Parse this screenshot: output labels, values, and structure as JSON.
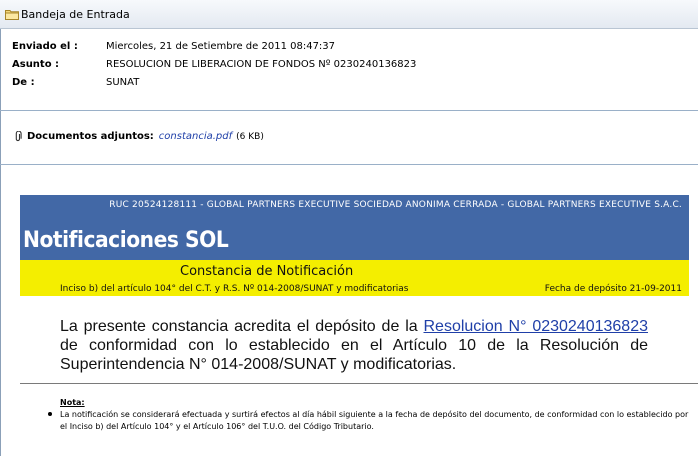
{
  "window": {
    "title": "Bandeja de Entrada",
    "icon": "folder-icon"
  },
  "headers": [
    {
      "label": "Enviado el :",
      "value": "Miercoles, 21 de Setiembre de 2011 08:47:37"
    },
    {
      "label": "Asunto :",
      "value": "RESOLUCION DE LIBERACION DE FONDOS Nº 0230240136823"
    },
    {
      "label": "De :",
      "value": "SUNAT"
    }
  ],
  "attachments": {
    "label": "Documentos adjuntos:",
    "file": "constancia.pdf",
    "size": "(6 KB)",
    "icon": "paperclip-icon"
  },
  "notice": {
    "ruc_line": "RUC 20524128111 - GLOBAL PARTNERS EXECUTIVE SOCIEDAD ANONIMA CERRADA - GLOBAL PARTNERS EXECUTIVE S.A.C.",
    "brand": "Notificaciones SOL",
    "constancia_title": "Constancia de Notificación",
    "inciso": "Inciso b) del artículo 104° del C.T. y R.S. Nº 014-2008/SUNAT y modificatorias",
    "fecha": "Fecha de depósito 21-09-2011",
    "body_before": "La presente constancia acredita el depósito de la ",
    "body_link": "Resolucion N° 0230240136823",
    "body_after": " de conformidad con lo establecido en el Artículo 10 de la Resolución de Superintendencia N° 014-2008/SUNAT y modificatorias.",
    "nota_title": "Nota:",
    "nota_text": "La notificación se considerará efectuada y surtirá efectos al día hábil siguiente a la fecha de depósito del documento, de conformidad con lo establecido por el Inciso b) del Artículo 104° y el Artículo 106° del T.U.O. del Código Tributario."
  },
  "colors": {
    "banner_blue": "#4268a6",
    "banner_yellow": "#f4ee00",
    "link_blue": "#1f3fa8"
  }
}
